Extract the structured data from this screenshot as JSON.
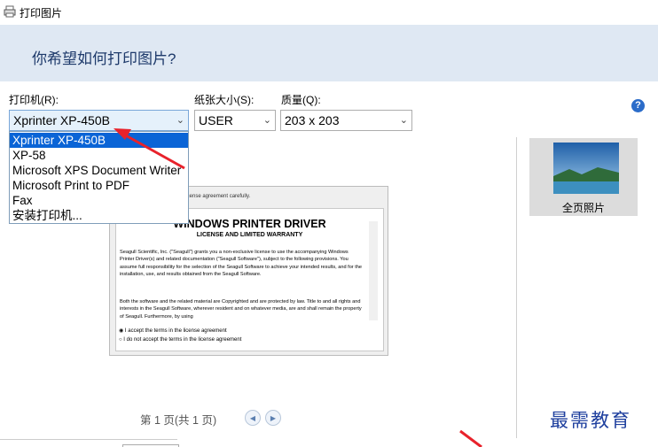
{
  "window": {
    "title": "打印图片"
  },
  "header": {
    "question": "你希望如何打印图片?"
  },
  "printer": {
    "label": "打印机(R):",
    "selected": "Xprinter XP-450B",
    "options": [
      "Xprinter XP-450B",
      "XP-58",
      "Microsoft XPS Document Writer",
      "Microsoft Print to PDF",
      "Fax",
      "安装打印机..."
    ]
  },
  "paper": {
    "label": "纸张大小(S):",
    "selected": "USER"
  },
  "quality": {
    "label": "质量(Q):",
    "selected": "203 x 203"
  },
  "layout": {
    "option_label": "全页照片"
  },
  "preview": {
    "intro": "license agreement carefully.",
    "doc_title": "WINDOWS PRINTER DRIVER",
    "doc_subtitle": "LICENSE AND LIMITED WARRANTY",
    "para1": "Seagull Scientific, Inc. (\"Seagull\") grants you a non-exclusive license to use the accompanying Windows Printer Driver(s) and related documentation (\"Seagull Software\"), subject to the following provisions. You assume full responsibility for the selection of the Seagull Software to achieve your intended results, and for the installation, use, and results obtained from the Seagull Software.",
    "para2": "Both the software and the related material are Copyrighted and are protected by law. Title to and all rights and interests in the Seagull Software, wherever resident and on whatever media, are and shall remain the property of Seagull. Furthermore, by using",
    "accept": "I accept the terms in the license agreement",
    "decline": "I do not accept the terms in the license agreement"
  },
  "pager": {
    "text": "第 1 页(共 1 页)"
  },
  "watermark": {
    "text": "最需教育"
  },
  "colors": {
    "header_bg": "#dfe8f3",
    "highlight": "#0a64d6",
    "arrow": "#e8222b"
  }
}
